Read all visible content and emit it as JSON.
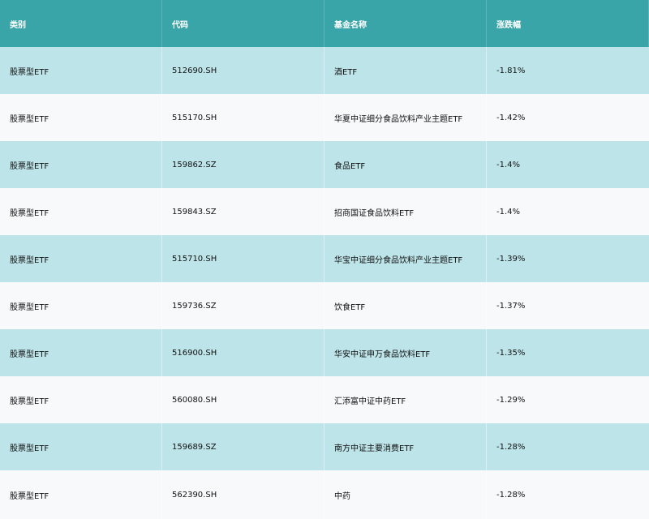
{
  "table": {
    "columns": [
      "类别",
      "代码",
      "基金名称",
      "涨跌幅"
    ],
    "rows": [
      [
        "股票型ETF",
        "512690.SH",
        "酒ETF",
        "-1.81%"
      ],
      [
        "股票型ETF",
        "515170.SH",
        "华夏中证细分食品饮料产业主题ETF",
        "-1.42%"
      ],
      [
        "股票型ETF",
        "159862.SZ",
        "食品ETF",
        "-1.4%"
      ],
      [
        "股票型ETF",
        "159843.SZ",
        "招商国证食品饮料ETF",
        "-1.4%"
      ],
      [
        "股票型ETF",
        "515710.SH",
        "华宝中证细分食品饮料产业主题ETF",
        "-1.39%"
      ],
      [
        "股票型ETF",
        "159736.SZ",
        "饮食ETF",
        "-1.37%"
      ],
      [
        "股票型ETF",
        "516900.SH",
        "华安中证申万食品饮料ETF",
        "-1.35%"
      ],
      [
        "股票型ETF",
        "560080.SH",
        "汇添富中证中药ETF",
        "-1.29%"
      ],
      [
        "股票型ETF",
        "159689.SZ",
        "南方中证主要消费ETF",
        "-1.28%"
      ],
      [
        "股票型ETF",
        "562390.SH",
        "中药",
        "-1.28%"
      ]
    ]
  }
}
